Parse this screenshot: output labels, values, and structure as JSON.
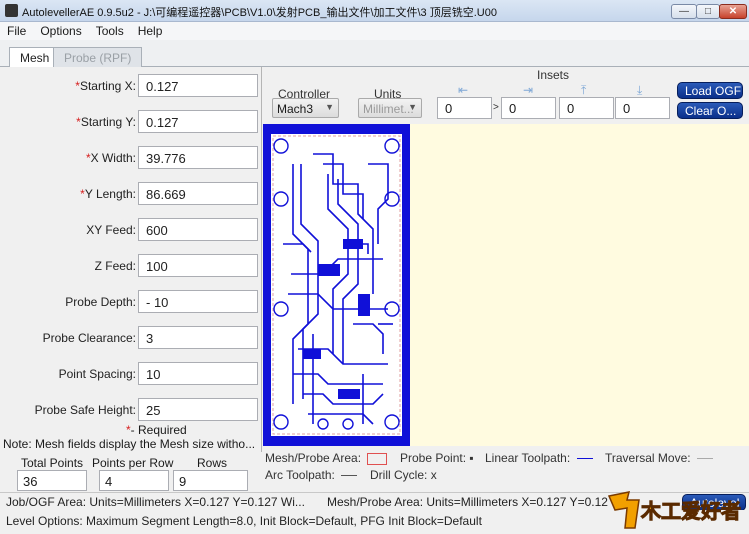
{
  "window": {
    "title": "AutolevellerAE 0.9.5u2 - J:\\可编程遥控器\\PCB\\V1.0\\发射PCB_输出文件\\加工文件\\3 顶层铣空.U00",
    "minimize": "—",
    "maximize": "□",
    "close": "✕"
  },
  "menu": [
    "File",
    "Options",
    "Tools",
    "Help"
  ],
  "tabs": [
    "Mesh",
    "Probe (RPF)"
  ],
  "mesh_fields": [
    {
      "label": "Starting X:",
      "value": "0.127",
      "required": true
    },
    {
      "label": "Starting Y:",
      "value": "0.127",
      "required": true
    },
    {
      "label": "X Width:",
      "value": "39.776",
      "required": true
    },
    {
      "label": "Y Length:",
      "value": "86.669",
      "required": true
    },
    {
      "label": "XY Feed:",
      "value": "600",
      "required": false
    },
    {
      "label": "Z Feed:",
      "value": "100",
      "required": false
    },
    {
      "label": "Probe Depth:",
      "value": "- 10",
      "required": false
    },
    {
      "label": "Probe Clearance:",
      "value": "3",
      "required": false
    },
    {
      "label": "Point Spacing:",
      "value": "10",
      "required": false
    },
    {
      "label": "Probe Safe Height:",
      "value": "25",
      "required": false
    }
  ],
  "required_star": "*",
  "required_note": "-  Required",
  "mesh_note": "Note: Mesh fields display the Mesh size witho...",
  "grid": {
    "total_points_label": "Total Points",
    "total_points": "36",
    "points_per_row_label": "Points per Row",
    "points_per_row": "4",
    "rows_label": "Rows",
    "rows": "9"
  },
  "toolbar": {
    "controller_label": "Controller",
    "controller_value": "Mach3",
    "units_label": "Units",
    "units_value": "Millimet...",
    "insets_label": "Insets",
    "insets": [
      "0",
      "0",
      "0",
      "0"
    ],
    "inset_icons": [
      "⇤",
      "⇥",
      "⤒",
      "⤓"
    ],
    "inset_sep": ">",
    "load_ogf": "Load OGF",
    "clear_ogf": "Clear O..."
  },
  "legend": {
    "mesh_probe_area": "Mesh/Probe Area:",
    "probe_point": "Probe Point:",
    "linear_toolpath": "Linear Toolpath:",
    "traversal_move": "Traversal Move:",
    "arc_toolpath": "Arc Toolpath:",
    "drill_cycle": "Drill Cycle:",
    "drill_cycle_symbol": "x",
    "probe_point_symbol": "▪"
  },
  "status": {
    "job_area": "Job/OGF Area: Units=Millimeters X=0.127 Y=0.127 Wi...",
    "mesh_area": "Mesh/Probe Area: Units=Millimeters X=0.127 Y=0.12",
    "level_options": "Level Options: Maximum Segment Length=8.0, Init Block=Default, PFG Init Block=Default",
    "autolevel_button": "Autolevel"
  },
  "watermark_text": "木工爱好者",
  "colors": {
    "pcb_blue": "#1010d8",
    "canvas_bg": "#fffbe0",
    "button_blue": "#0a2f8a",
    "required_red": "#d62020"
  }
}
